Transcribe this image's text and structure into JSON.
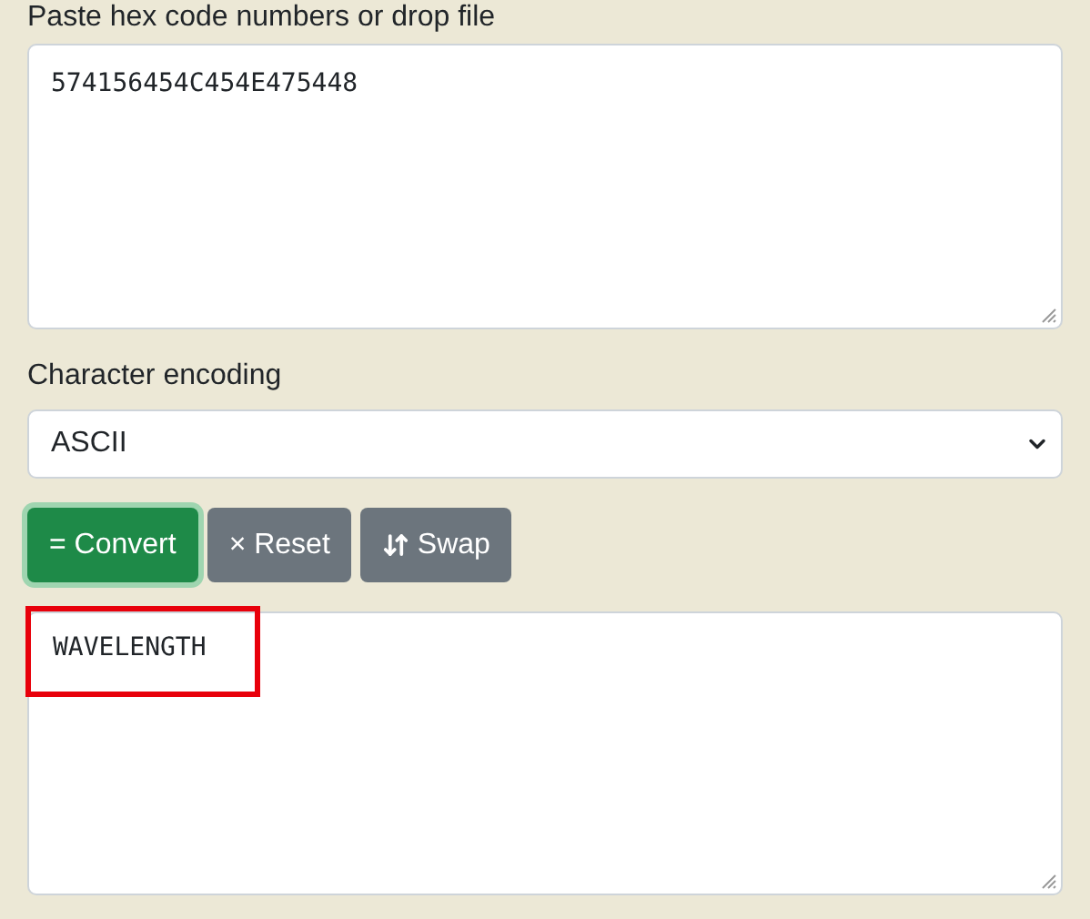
{
  "input": {
    "label": "Paste hex code numbers or drop file",
    "value": "574156454C454E475448"
  },
  "encoding": {
    "label": "Character encoding",
    "value": "ASCII"
  },
  "buttons": [
    {
      "kind": "primary",
      "label": "= Convert",
      "focused": true
    },
    {
      "kind": "secondary",
      "label": "× Reset",
      "focused": false
    },
    {
      "kind": "swap",
      "label": "Swap",
      "focused": false
    }
  ],
  "output": {
    "value": "WAVELENGTH",
    "highlighted": true
  }
}
